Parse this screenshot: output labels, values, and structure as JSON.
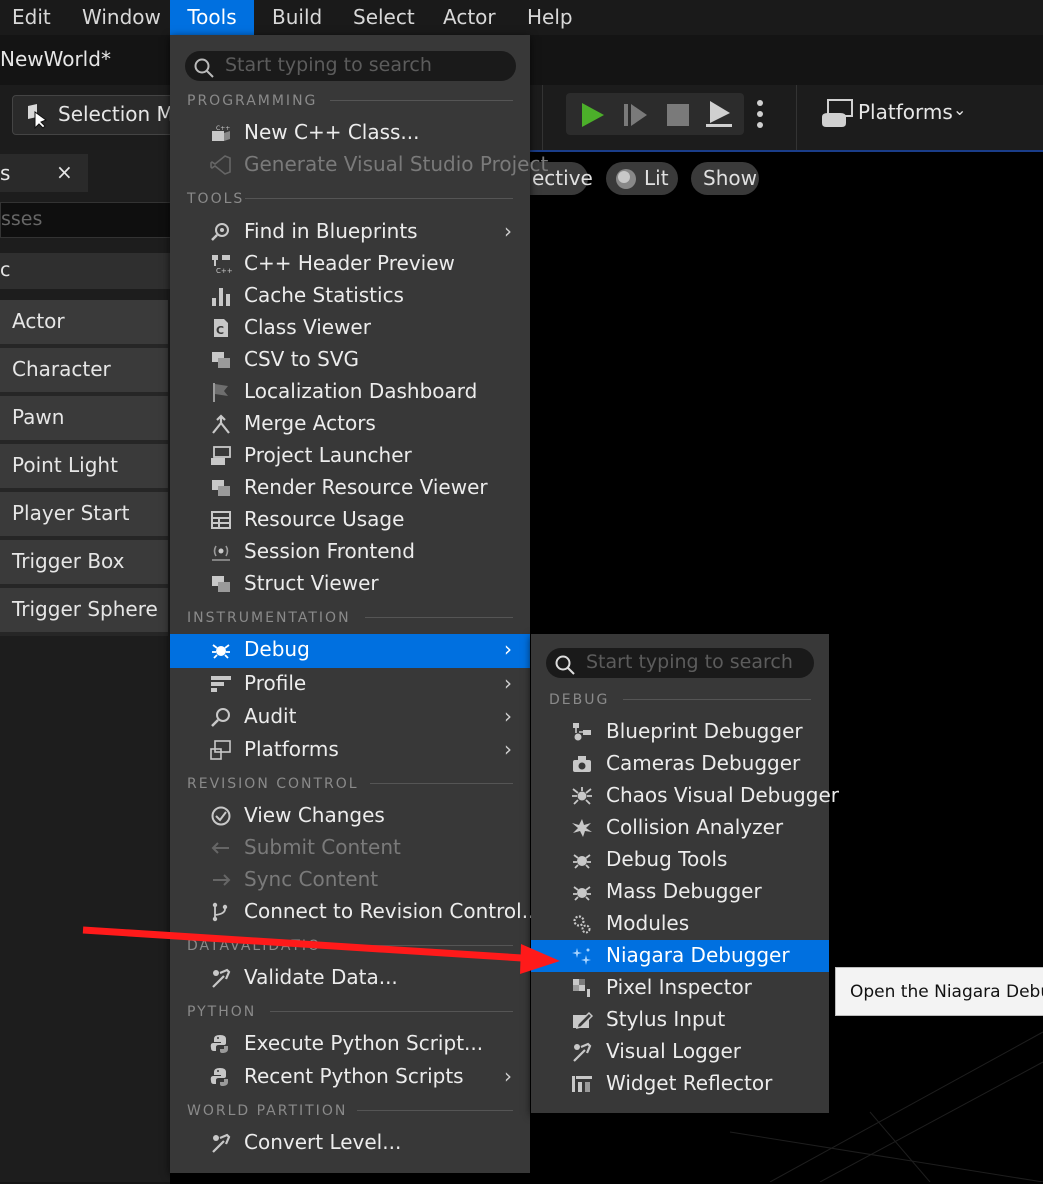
{
  "menubar": {
    "items": [
      "Edit",
      "Window",
      "Tools",
      "Build",
      "Select",
      "Actor",
      "Help"
    ]
  },
  "title": "NewWorld*",
  "toolbar": {
    "selection_mode": "Selection Mo",
    "platforms": "Platforms"
  },
  "left_panel": {
    "tab_label": "s",
    "close": "×",
    "search_placeholder": "sses",
    "category": "c",
    "items": [
      "Actor",
      "Character",
      "Pawn",
      "Point Light",
      "Player Start",
      "Trigger Box",
      "Trigger Sphere"
    ]
  },
  "viewport": {
    "perspective": "ective",
    "lit": "Lit",
    "show": "Show"
  },
  "tools_menu": {
    "search_placeholder": "Start typing to search",
    "sections": {
      "programming": "PROGRAMMING",
      "tools": "TOOLS",
      "instrumentation": "INSTRUMENTATION",
      "revision": "REVISION CONTROL",
      "datavalidation": "DATAVALIDATIO",
      "python": "PYTHON",
      "world": "WORLD PARTITION"
    },
    "items": {
      "new_cpp": "New C++ Class...",
      "gen_vs": "Generate Visual Studio Project",
      "find_bp": "Find in Blueprints",
      "cpp_header": "C++ Header Preview",
      "cache_stats": "Cache Statistics",
      "class_viewer": "Class Viewer",
      "csv_svg": "CSV to SVG",
      "loc_dash": "Localization Dashboard",
      "merge": "Merge Actors",
      "launcher": "Project Launcher",
      "render_res": "Render Resource Viewer",
      "res_usage": "Resource Usage",
      "session": "Session Frontend",
      "struct": "Struct Viewer",
      "debug": "Debug",
      "profile": "Profile",
      "audit": "Audit",
      "platforms": "Platforms",
      "view_changes": "View Changes",
      "submit": "Submit Content",
      "sync": "Sync Content",
      "connect": "Connect to Revision Control...",
      "validate": "Validate Data...",
      "exec_py": "Execute Python Script...",
      "recent_py": "Recent Python Scripts",
      "convert": "Convert Level..."
    }
  },
  "debug_menu": {
    "search_placeholder": "Start typing to search",
    "section": "DEBUG",
    "items": {
      "bp_dbg": "Blueprint Debugger",
      "cam_dbg": "Cameras Debugger",
      "chaos": "Chaos Visual Debugger",
      "collision": "Collision Analyzer",
      "debug_tools": "Debug Tools",
      "mass": "Mass Debugger",
      "modules": "Modules",
      "niagara": "Niagara Debugger",
      "pixel": "Pixel Inspector",
      "stylus": "Stylus Input",
      "vislog": "Visual Logger",
      "widget": "Widget Reflector"
    }
  },
  "tooltip": "Open the Niagara Debug",
  "colors": {
    "accent": "#0070e0",
    "arrow": "#ff1a1a",
    "play": "#4caf2a"
  }
}
